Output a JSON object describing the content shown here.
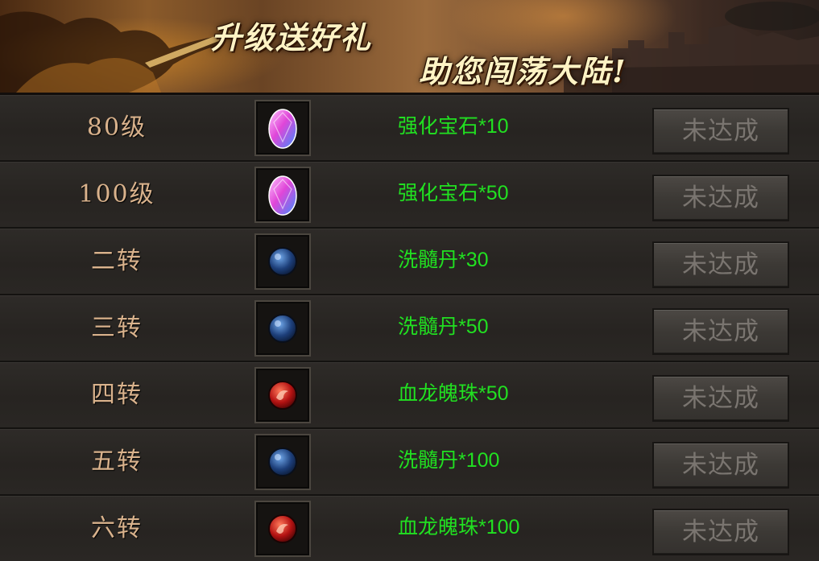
{
  "banner": {
    "line1": "升级送好礼",
    "line2": "助您闯荡大陆!"
  },
  "rewards": [
    {
      "level": "80级",
      "reward": "强化宝石*10",
      "item_icon": "pink-gem-icon",
      "status": "未达成"
    },
    {
      "level": "100级",
      "reward": "强化宝石*50",
      "item_icon": "pink-gem-icon",
      "status": "未达成"
    },
    {
      "level": "二转",
      "reward": "洗髓丹*30",
      "item_icon": "blue-orb-icon",
      "status": "未达成"
    },
    {
      "level": "三转",
      "reward": "洗髓丹*50",
      "item_icon": "blue-orb-icon",
      "status": "未达成"
    },
    {
      "level": "四转",
      "reward": "血龙魄珠*50",
      "item_icon": "red-orb-icon",
      "status": "未达成"
    },
    {
      "level": "五转",
      "reward": "洗髓丹*100",
      "item_icon": "blue-orb-icon",
      "status": "未达成"
    },
    {
      "level": "六转",
      "reward": "血龙魄珠*100",
      "item_icon": "red-orb-icon",
      "status": "未达成"
    }
  ],
  "colors": {
    "reward_text": "#21e021",
    "level_text": "#d9b28c",
    "button_text": "#7a7570"
  }
}
